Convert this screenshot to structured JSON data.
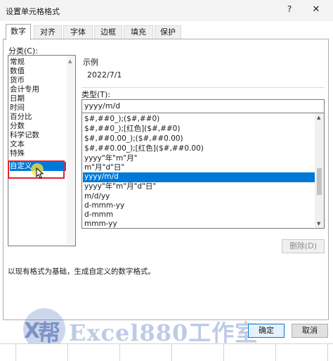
{
  "window": {
    "title": "设置单元格格式",
    "help_label": "?",
    "close_label": "✕"
  },
  "tabs": [
    {
      "label": "数字",
      "active": true
    },
    {
      "label": "对齐",
      "active": false
    },
    {
      "label": "字体",
      "active": false
    },
    {
      "label": "边框",
      "active": false
    },
    {
      "label": "填充",
      "active": false
    },
    {
      "label": "保护",
      "active": false
    }
  ],
  "category": {
    "label": "分类(C):",
    "items": [
      "常规",
      "数值",
      "货币",
      "会计专用",
      "日期",
      "时间",
      "百分比",
      "分数",
      "科学记数",
      "文本",
      "特殊",
      "自定义"
    ],
    "selected_index": 11
  },
  "sample": {
    "label": "示例",
    "value": "2022/7/1"
  },
  "type_field": {
    "label": "类型(T):",
    "value": "yyyy/m/d"
  },
  "formats": {
    "items": [
      "$#,##0_);($#,##0)",
      "$#,##0_);[红色]($#,##0)",
      "$#,##0.00_);($#,##0.00)",
      "$#,##0.00_);[红色]($#,##0.00)",
      "yyyy\"年\"m\"月\"",
      "m\"月\"d\"日\"",
      "yyyy/m/d",
      "yyyy\"年\"m\"月\"d\"日\"",
      "m/d/yy",
      "d-mmm-yy",
      "d-mmm",
      "mmm-yy"
    ],
    "selected_index": 6
  },
  "delete_button": "删除(D)",
  "description": "以现有格式为基础，生成自定义的数字格式。",
  "footer": {
    "ok_label": "确定",
    "cancel_label": "取消"
  },
  "watermark": {
    "logo_char": "X",
    "logo_glyph": "帮",
    "text": "Excel880工作室"
  },
  "colors": {
    "selection": "#0078d7",
    "highlight_box": "#e3242b",
    "watermark": "#6e8cc8"
  }
}
